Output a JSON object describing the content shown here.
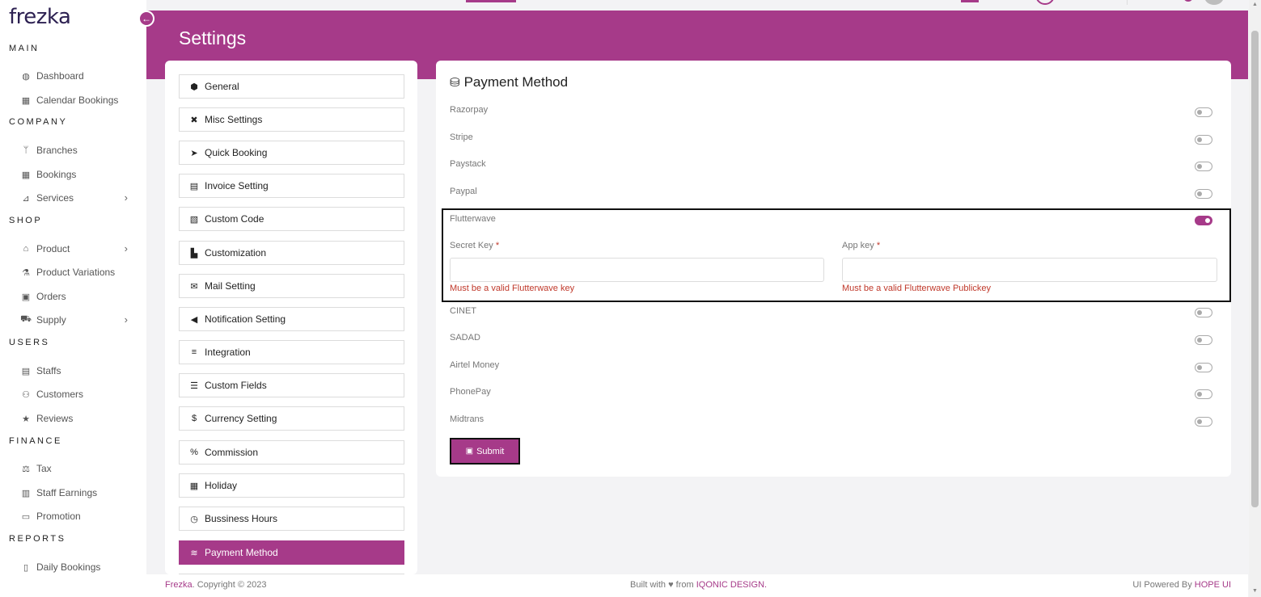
{
  "app": {
    "logo": "frezka",
    "page_title": "Settings"
  },
  "sidebar": {
    "sections": [
      {
        "label": "MAIN",
        "items": [
          {
            "label": "Dashboard",
            "icon": "dashboard-icon"
          },
          {
            "label": "Calendar Bookings",
            "icon": "calendar-icon"
          }
        ]
      },
      {
        "label": "COMPANY",
        "items": [
          {
            "label": "Branches",
            "icon": "branch-icon"
          },
          {
            "label": "Bookings",
            "icon": "calendar-icon"
          },
          {
            "label": "Services",
            "icon": "services-icon",
            "expandable": true
          }
        ]
      },
      {
        "label": "SHOP",
        "items": [
          {
            "label": "Product",
            "icon": "store-icon",
            "expandable": true
          },
          {
            "label": "Product Variations",
            "icon": "variations-icon"
          },
          {
            "label": "Orders",
            "icon": "bag-icon"
          },
          {
            "label": "Supply",
            "icon": "truck-icon",
            "expandable": true
          }
        ]
      },
      {
        "label": "USERS",
        "items": [
          {
            "label": "Staffs",
            "icon": "id-card-icon"
          },
          {
            "label": "Customers",
            "icon": "users-icon"
          },
          {
            "label": "Reviews",
            "icon": "star-icon"
          }
        ]
      },
      {
        "label": "FINANCE",
        "items": [
          {
            "label": "Tax",
            "icon": "tax-icon"
          },
          {
            "label": "Staff Earnings",
            "icon": "money-icon"
          },
          {
            "label": "Promotion",
            "icon": "promotion-icon"
          }
        ]
      },
      {
        "label": "REPORTS",
        "items": [
          {
            "label": "Daily Bookings",
            "icon": "report-icon"
          }
        ]
      }
    ]
  },
  "settings_menu": [
    {
      "label": "General",
      "icon": "cube-icon"
    },
    {
      "label": "Misc Settings",
      "icon": "tools-icon"
    },
    {
      "label": "Quick Booking",
      "icon": "paper-plane-icon"
    },
    {
      "label": "Invoice Setting",
      "icon": "file-icon"
    },
    {
      "label": "Custom Code",
      "icon": "file-code-icon"
    },
    {
      "label": "Customization",
      "icon": "palette-icon"
    },
    {
      "label": "Mail Setting",
      "icon": "envelope-icon"
    },
    {
      "label": "Notification Setting",
      "icon": "bullhorn-icon"
    },
    {
      "label": "Integration",
      "icon": "sliders-icon"
    },
    {
      "label": "Custom Fields",
      "icon": "list-icon"
    },
    {
      "label": "Currency Setting",
      "icon": "dollar-icon"
    },
    {
      "label": "Commission",
      "icon": "percent-icon"
    },
    {
      "label": "Holiday",
      "icon": "calendar-check-icon"
    },
    {
      "label": "Bussiness Hours",
      "icon": "clock-icon"
    },
    {
      "label": "Payment Method",
      "icon": "coins-icon",
      "active": true
    }
  ],
  "payment": {
    "title": "Payment Method",
    "gateways": [
      {
        "name": "Razorpay",
        "enabled": false
      },
      {
        "name": "Stripe",
        "enabled": false
      },
      {
        "name": "Paystack",
        "enabled": false
      },
      {
        "name": "Paypal",
        "enabled": false
      },
      {
        "name": "Flutterwave",
        "enabled": true
      },
      {
        "name": "CINET",
        "enabled": false
      },
      {
        "name": "SADAD",
        "enabled": false
      },
      {
        "name": "Airtel Money",
        "enabled": false
      },
      {
        "name": "PhonePay",
        "enabled": false
      },
      {
        "name": "Midtrans",
        "enabled": false
      }
    ],
    "flutterwave": {
      "secret_key_label": "Secret Key",
      "secret_key_value": "",
      "secret_key_error": "Must be a valid Flutterwave key",
      "app_key_label": "App key",
      "app_key_value": "",
      "app_key_error": "Must be a valid Flutterwave Publickey",
      "required_mark": "*"
    },
    "submit_label": "Submit"
  },
  "footer": {
    "brand": "Frezka",
    "copyright": ". Copyright © 2023",
    "built_with": "Built with ♥ from ",
    "built_by": "IQONIC DESIGN.",
    "powered_by": "UI Powered By ",
    "powered_brand": "HOPE UI"
  },
  "colors": {
    "accent": "#a63a89",
    "logo": "#2d2152",
    "error": "#c0392b"
  }
}
